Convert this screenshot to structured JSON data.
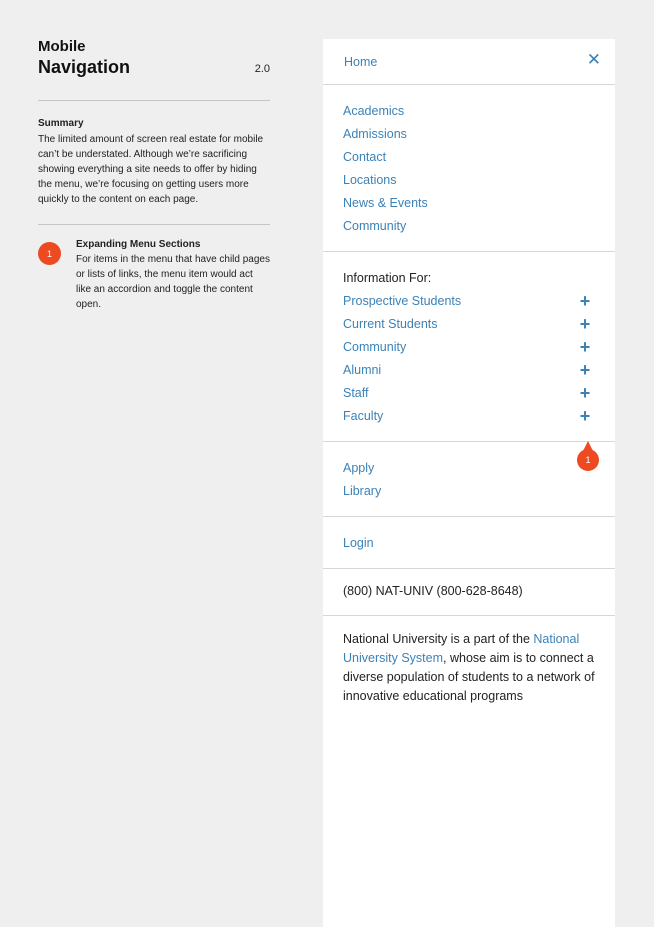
{
  "doc": {
    "title_line1": "Mobile",
    "title_line2": "Navigation",
    "version": "2.0",
    "summary_label": "Summary",
    "summary_text": "The limited amount of screen real estate for mobile can’t be understated. Although we’re sacrificing showing everything a site needs to offer by hiding the menu, we’re focusing on getting users more quickly to the content on each page.",
    "note": {
      "number": "1",
      "title": "Expanding Menu Sections",
      "text": "For items in the menu that have child pages or lists of links, the menu item would act like an accordion and toggle the content open."
    }
  },
  "menu": {
    "home": "Home",
    "close_icon": "close-icon",
    "main_links": [
      "Academics",
      "Admissions",
      "Contact",
      "Locations",
      "News & Events",
      "Community"
    ],
    "info_label": "Information For:",
    "accordion_items": [
      "Prospective Students",
      "Current Students",
      "Community",
      "Alumni",
      "Staff",
      "Faculty"
    ],
    "secondary_links": [
      "Apply",
      "Library"
    ],
    "login": "Login",
    "phone": "(800) NAT-UNIV (800-628-8648)",
    "about": {
      "prefix": "National University is a part of the ",
      "link": "National University System",
      "suffix": ", whose aim is to connect a diverse population of students to a network of innovative educational programs"
    },
    "callout_number": "1"
  },
  "colors": {
    "link": "#3b82b7",
    "accent": "#ee4a21",
    "background": "#efefef"
  }
}
